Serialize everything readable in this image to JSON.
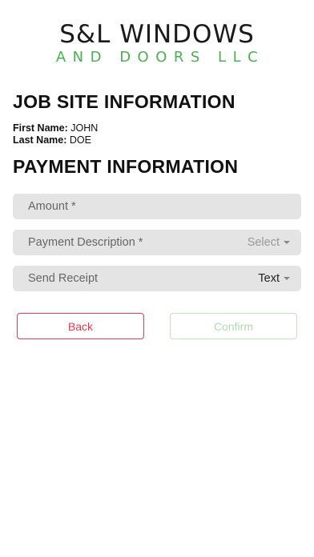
{
  "logo": {
    "line1": "S&L WINDOWS",
    "line2": "AND DOORS LLC"
  },
  "job_site": {
    "title": "JOB SITE INFORMATION",
    "first_name_label": "First Name:",
    "first_name_value": "JOHN",
    "last_name_label": "Last Name:",
    "last_name_value": "DOE"
  },
  "payment": {
    "title": "PAYMENT INFORMATION",
    "amount_placeholder": "Amount *",
    "description_label": "Payment Description *",
    "description_value": "Select",
    "receipt_label": "Send Receipt",
    "receipt_value": "Text"
  },
  "buttons": {
    "back": "Back",
    "confirm": "Confirm"
  },
  "colors": {
    "logo_accent": "#4caf50",
    "back_button": "#e53950",
    "confirm_button_disabled": "#b3d6b3",
    "field_background": "#e4e4e4"
  }
}
